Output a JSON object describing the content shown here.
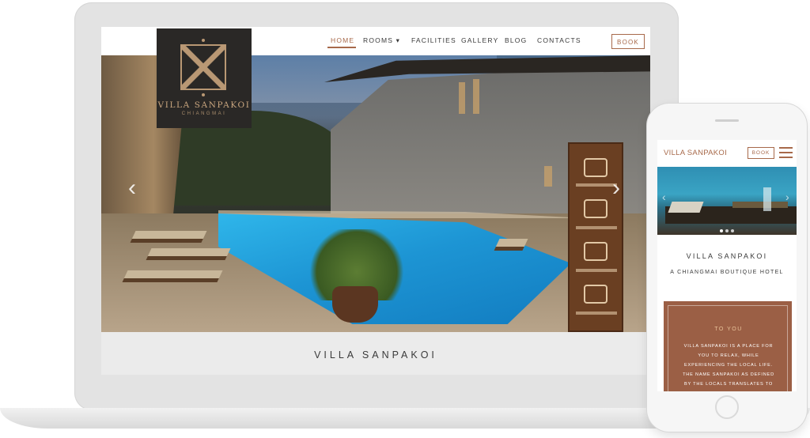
{
  "desktop": {
    "nav": {
      "items": [
        {
          "label": "HOME",
          "active": true
        },
        {
          "label": "ROOMS ▾"
        },
        {
          "label": "FACILITIES"
        },
        {
          "label": "GALLERY"
        },
        {
          "label": "BLOG"
        },
        {
          "label": "CONTACTS"
        }
      ],
      "book_label": "BOOK"
    },
    "logo": {
      "name": "VILLA SANPAKOI",
      "sub": "CHIANGMAI"
    },
    "hero": {
      "slide_count": 3,
      "active_slide": 1,
      "prev_arrow": "‹",
      "next_arrow": "›"
    },
    "caption": "VILLA SANPAKOI"
  },
  "mobile": {
    "logo": "VILLA SANPAKOI",
    "book_label": "BOOK",
    "hero": {
      "slide_count": 3,
      "active_slide": 1,
      "prev_arrow": "‹",
      "next_arrow": "›"
    },
    "name": "VILLA SANPAKOI",
    "tagline": "A CHIANGMAI BOUTIQUE HOTEL",
    "card": {
      "title": "TO YOU",
      "lines": [
        "VILLA SANPAKOI IS A PLACE FOR",
        "YOU TO RELAX, WHILE",
        "EXPERIENCING THE LOCAL LIFE.",
        "THE NAME SANPAKOI AS DEFINED",
        "BY THE LOCALS TRANSLATES TO"
      ]
    }
  },
  "icons": {
    "menu": "hamburger-menu-icon",
    "rooms_dropdown": "chevron-down-icon"
  },
  "colors": {
    "accent": "#a7694a",
    "logo_bg": "#2a2826",
    "card_bg": "#9b5f45",
    "caption_bg": "#ebebeb"
  }
}
